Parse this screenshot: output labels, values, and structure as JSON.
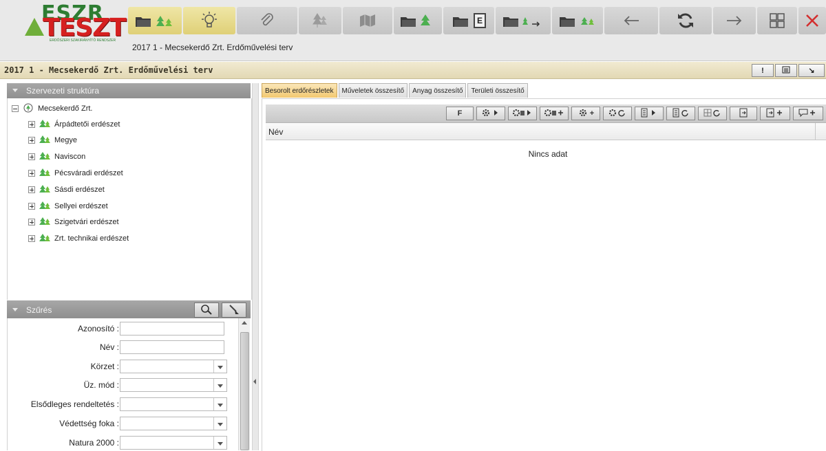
{
  "app": {
    "logo_top": "ESZR",
    "logo_main": "TESZT",
    "logo_sub": "ERDŐSZERI SZAKIRÁNYÍTÓ RENDSZER",
    "title": "2017 1 - Mecsekerdő Zrt. Erdőművelési terv"
  },
  "toolbar": {
    "icons": [
      "folder-trees-icon",
      "lightbulb-icon",
      "paperclip-icon",
      "trees-icon",
      "map-icon",
      "folder-forest-icon",
      "folder-e-icon",
      "folder-arrow-icon",
      "folder-trees-small-icon",
      "back-arrow-icon",
      "refresh-icon",
      "forward-arrow-icon",
      "layout-grid-icon",
      "close-icon"
    ],
    "folder_e_letter": "E",
    "accent_close": "#d32f2f"
  },
  "pagebar": {
    "title": "2017 1 - Mecsekerdő Zrt. Erdőművelési terv",
    "btn1": "!",
    "btn3": "↘"
  },
  "left": {
    "structure_title": "Szervezeti struktúra",
    "root": "Mecsekerdő Zrt.",
    "children": [
      "Árpádtetői erdészet",
      "Megye",
      "Naviscon",
      "Pécsváradi erdészet",
      "Sásdi erdészet",
      "Sellyei erdészet",
      "Szigetvári erdészet",
      "Zrt. technikai erdészet"
    ],
    "filter_title": "Szűrés",
    "filters": [
      {
        "label": "Azonosító :",
        "type": "text",
        "value": ""
      },
      {
        "label": "Név :",
        "type": "text",
        "value": ""
      },
      {
        "label": "Körzet :",
        "type": "select",
        "value": ""
      },
      {
        "label": "Üz. mód :",
        "type": "select",
        "value": ""
      },
      {
        "label": "Elsődleges rendeltetés :",
        "type": "select",
        "value": ""
      },
      {
        "label": "Védettség foka :",
        "type": "select",
        "value": ""
      },
      {
        "label": "Natura 2000 :",
        "type": "select",
        "value": ""
      }
    ]
  },
  "right": {
    "tabs": [
      "Besorolt erdőrészletek",
      "Műveletek összesítő",
      "Anyag összesítő",
      "Területi összesítő"
    ],
    "active_tab": 0,
    "grid_buttons": {
      "f": "F",
      "plus": "+"
    },
    "column_name": "Név",
    "empty_text": "Nincs adat"
  },
  "colors": {
    "page_bar": "#e9e0c0",
    "active_tab": "#f4c86e",
    "panel_header": "#9b9b9b",
    "tree_green": "#4caf50"
  }
}
